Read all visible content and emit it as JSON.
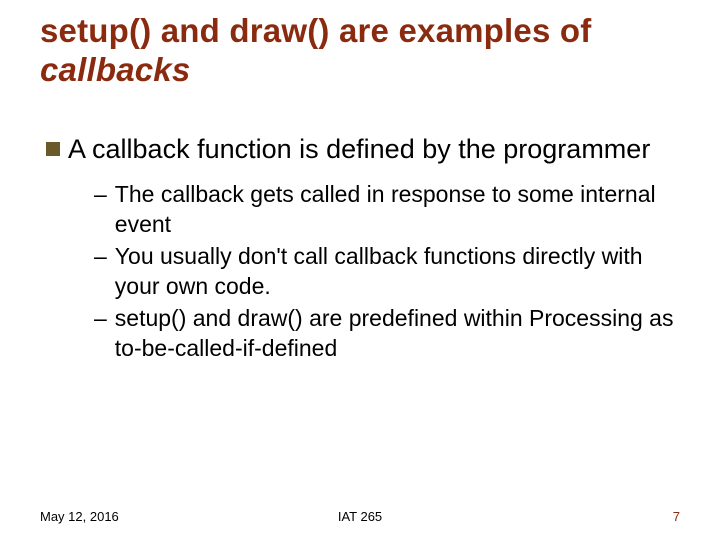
{
  "title": {
    "part1": "setup() and draw() are examples of ",
    "part2_em": "callbacks"
  },
  "body": {
    "main": "A callback function is defined by the programmer",
    "subs": [
      "The callback gets called in response to some internal event",
      "You usually don't call callback functions directly with your own code.",
      "setup() and draw() are predefined within Processing as   to-be-called-if-defined"
    ]
  },
  "footer": {
    "date": "May 12, 2016",
    "center": "IAT 265",
    "page": "7"
  }
}
